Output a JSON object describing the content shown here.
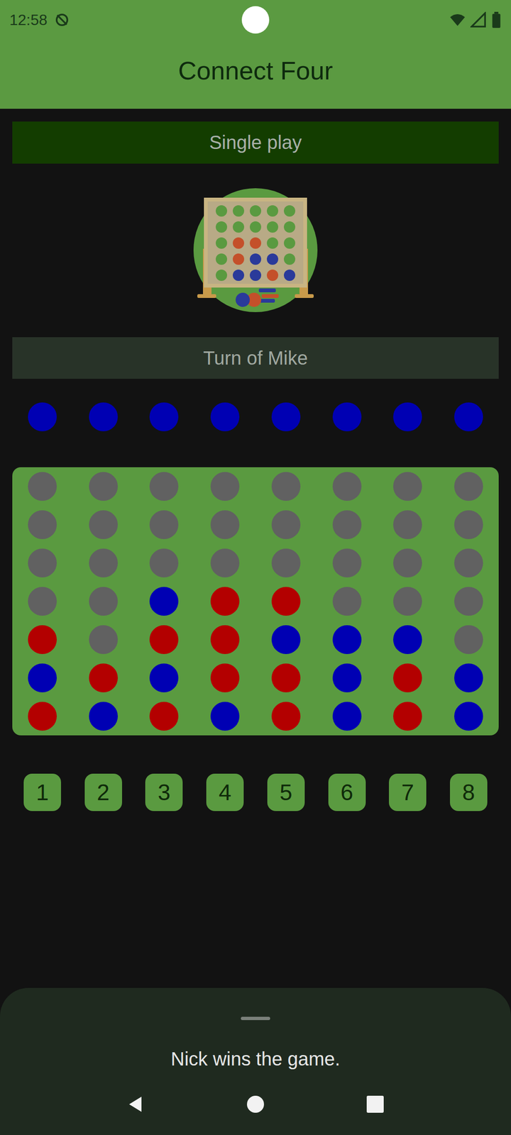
{
  "status_bar": {
    "time": "12:58"
  },
  "app_bar": {
    "title": "Connect Four"
  },
  "mode": {
    "label": "Single play"
  },
  "turn": {
    "label": "Turn of Mike"
  },
  "discs": {
    "red": "#b30000",
    "blue": "#0000b3",
    "empty": "#616161"
  },
  "drop_markers": [
    "blue",
    "blue",
    "blue",
    "blue",
    "blue",
    "blue",
    "blue",
    "blue"
  ],
  "board": [
    [
      "empty",
      "empty",
      "empty",
      "empty",
      "empty",
      "empty",
      "empty",
      "empty"
    ],
    [
      "empty",
      "empty",
      "empty",
      "empty",
      "empty",
      "empty",
      "empty",
      "empty"
    ],
    [
      "empty",
      "empty",
      "empty",
      "empty",
      "empty",
      "empty",
      "empty",
      "empty"
    ],
    [
      "empty",
      "empty",
      "blue",
      "red",
      "red",
      "empty",
      "empty",
      "empty"
    ],
    [
      "red",
      "empty",
      "red",
      "red",
      "blue",
      "blue",
      "blue",
      "empty"
    ],
    [
      "blue",
      "red",
      "blue",
      "red",
      "red",
      "blue",
      "red",
      "blue"
    ],
    [
      "red",
      "blue",
      "red",
      "blue",
      "red",
      "blue",
      "red",
      "blue"
    ]
  ],
  "column_buttons": [
    "1",
    "2",
    "3",
    "4",
    "5",
    "6",
    "7",
    "8"
  ],
  "message": {
    "text": "Nick wins the game."
  }
}
